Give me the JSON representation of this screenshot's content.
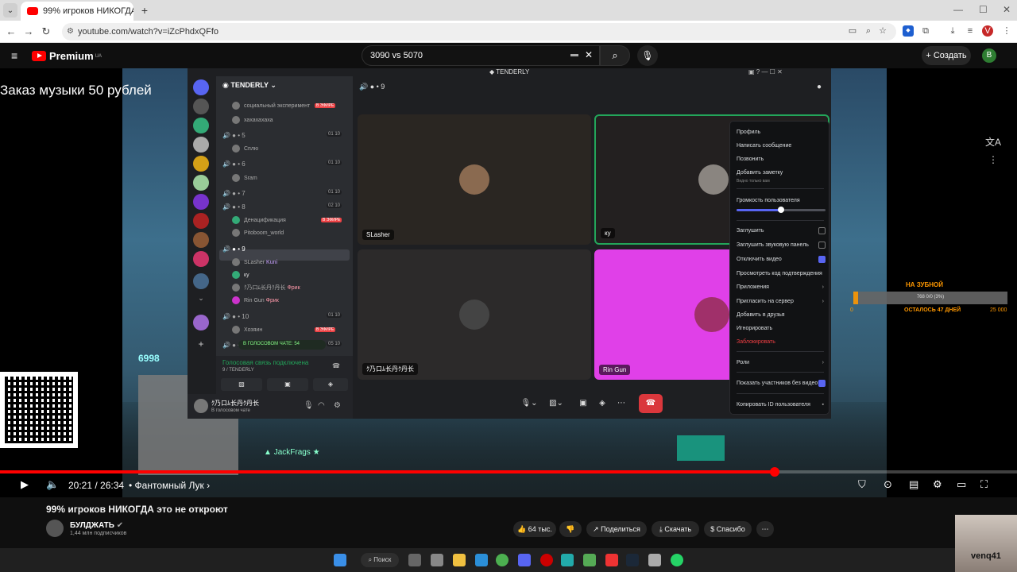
{
  "browser": {
    "tab_title": "99% игроков НИКОГДА это не",
    "url": "youtube.com/watch?v=iZcPhdxQFfo"
  },
  "youtube": {
    "logo": "Premium",
    "region": "UA",
    "search_value": "3090 vs 5070",
    "create_label": "Создать",
    "avatar_letter": "B"
  },
  "stream": {
    "promo_text": "Заказ музыки 50 рублей",
    "score": "6998",
    "killfeed_player": "JackFrags",
    "donate_title": "НА ЗУБНОЙ",
    "donate_progress_text": "768 0/0 (3%)",
    "donate_min": "0",
    "donate_days": "ОСТАЛОСЬ 47 ДНЕЙ",
    "donate_max": "25 000",
    "donate_fraction": 0.03
  },
  "discord": {
    "app_title": "TENDERLY",
    "server_name": "TENDERLY",
    "channels": [
      {
        "name": "социальный эксперимент",
        "badge": "В ЭФИРЕ"
      },
      {
        "name": "хахахахаха"
      },
      {
        "name": "5",
        "count": "01 10"
      },
      {
        "name": "Сплю"
      },
      {
        "name": "6",
        "count": "01 10"
      },
      {
        "name": "Sram"
      },
      {
        "name": "7",
        "count": "01 10"
      },
      {
        "name": "8",
        "count": "02 10"
      },
      {
        "name": "Денацификация",
        "badge": "В ЭФИРЕ"
      },
      {
        "name": "Pitoboom_world"
      },
      {
        "name": "9"
      },
      {
        "name": "SLasher",
        "tag": "Kuni"
      },
      {
        "name": "ку"
      },
      {
        "name": "ｸ乃口ﾑ长丹ｸ丹长",
        "tag": "Фрик"
      },
      {
        "name": "Rin Gun",
        "tag": "Фрик"
      },
      {
        "name": "10",
        "count": "01 10"
      },
      {
        "name": "Хозяин",
        "badge": "В ЭФИРЕ"
      },
      {
        "name": "11",
        "count": "05 10"
      }
    ],
    "voice_chat_label": "В ГОЛОСОВОМ ЧАТЕ: 54",
    "voice_status": "Голосовая связь подключена",
    "voice_sub": "9 / TENDERLY",
    "user_name": "ｸ乃口ﾑ长丹ｸ丹长",
    "user_sub": "В голосовом чате",
    "call_channel": "9",
    "tiles": [
      {
        "name": "SLasher"
      },
      {
        "name": "ку"
      },
      {
        "name": "ｸ乃口ﾑ长丹ｸ丹长"
      },
      {
        "name": "Rin Gun"
      }
    ],
    "menu": {
      "profile": "Профиль",
      "message": "Написать сообщение",
      "call": "Позвонить",
      "note": "Добавить заметку",
      "note_sub": "Видно только вам",
      "volume": "Громкость пользователя",
      "volume_value": 0.5,
      "mute": "Заглушить",
      "mute_sound": "Заглушить звуковую панель",
      "disable_video": "Отключить видео",
      "verify_code": "Просмотреть код подтверждения",
      "apps": "Приложения",
      "invite": "Пригласить на сервер",
      "add_friend": "Добавить в друзья",
      "ignore": "Игнорировать",
      "block": "Заблокировать",
      "roles": "Роли",
      "show_no_video": "Показать участников без видео",
      "copy_id": "Копировать ID пользователя"
    }
  },
  "player": {
    "time": "20:21 / 26:34",
    "chapter": "• Фантомный Лук",
    "progress_fraction": 0.762
  },
  "video_info": {
    "title": "99% игроков НИКОГДА это не откроют",
    "channel": "БУЛДЖАТЬ",
    "subscribers": "1,44 млн подписчиков",
    "likes": "64 тыс.",
    "share": "Поделиться",
    "download": "Скачать",
    "thanks": "Спасибо"
  },
  "taskbar": {
    "search_label": "Поиск"
  },
  "webcam": {
    "name": "venq41"
  }
}
